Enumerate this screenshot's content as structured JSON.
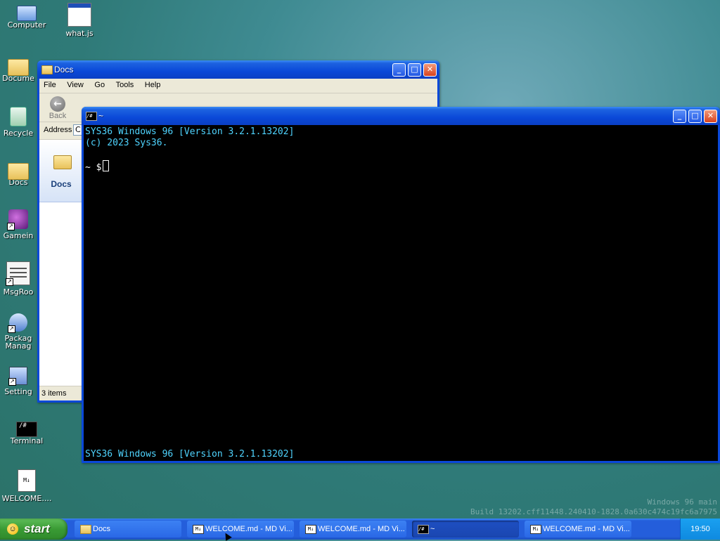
{
  "desktop": {
    "icons": [
      {
        "label": "Computer"
      },
      {
        "label": "what.js"
      },
      {
        "label": "Docume"
      },
      {
        "label": "Recycle"
      },
      {
        "label": "Docs"
      },
      {
        "label": "Gamein"
      },
      {
        "label": "MsgRoo"
      },
      {
        "label": "Packag Manag"
      },
      {
        "label": "Setting"
      },
      {
        "label": "Terminal"
      },
      {
        "label": "WELCOME...."
      }
    ]
  },
  "explorer": {
    "title": "Docs",
    "menu": [
      "File",
      "View",
      "Go",
      "Tools",
      "Help"
    ],
    "back_label": "Back",
    "address_label": "Address",
    "address_value": "C",
    "side_title": "Docs",
    "status": "3 items"
  },
  "terminal": {
    "title": "~",
    "lines": [
      "SYS36 Windows 96 [Version 3.2.1.13202]",
      "(c) 2023 Sys36."
    ],
    "prompt": "~ $",
    "footer": "SYS36 Windows 96 [Version 3.2.1.13202]"
  },
  "watermark": {
    "line1": "Windows 96 main",
    "line2": "Build 13202.cff11448.240410-1828.0a630c474c19fc6a7975"
  },
  "taskbar": {
    "start_label": "start",
    "tasks": [
      {
        "label": "Docs",
        "icon": "folder-icon"
      },
      {
        "label": "WELCOME.md - MD Vi...",
        "icon": "md-icon"
      },
      {
        "label": "WELCOME.md - MD Vi...",
        "icon": "md-icon"
      },
      {
        "label": "~",
        "icon": "terminal-icon"
      },
      {
        "label": "WELCOME.md - MD Vi...",
        "icon": "md-icon"
      }
    ],
    "clock": "19:50"
  },
  "colors": {
    "titlebar": "#0a48d8",
    "terminal_text": "#4fd4ff",
    "taskbar": "#245edb",
    "start": "#3a9b35"
  }
}
